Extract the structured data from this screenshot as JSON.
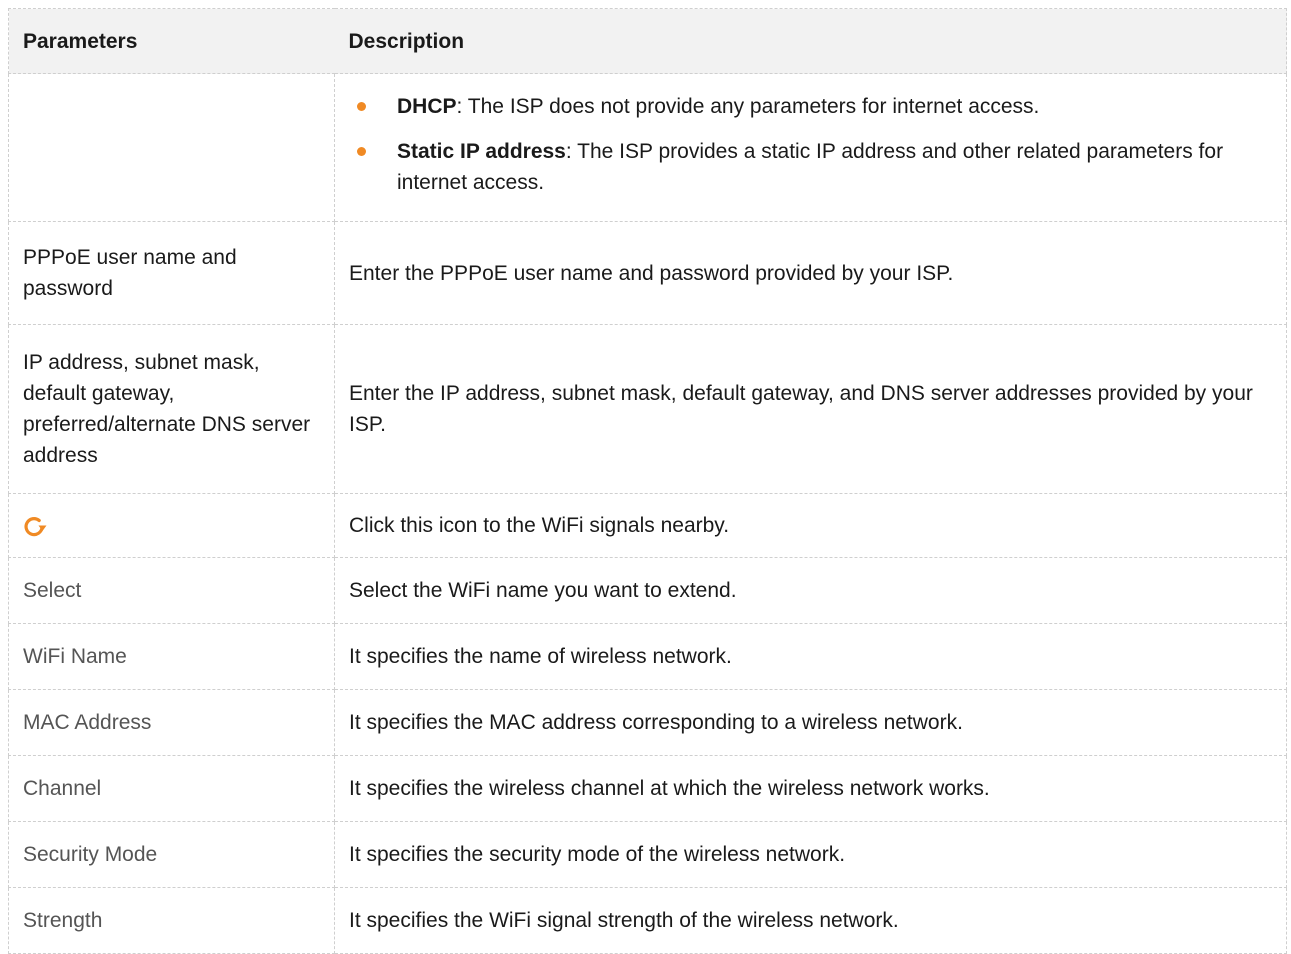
{
  "header": {
    "parameters": "Parameters",
    "description": "Description"
  },
  "bullet_row": {
    "items": [
      {
        "term": "DHCP",
        "text": ": The ISP does not provide any parameters for internet access."
      },
      {
        "term": "Static IP address",
        "text": ": The ISP provides a static IP address and other related parameters for internet access."
      }
    ]
  },
  "rows": [
    {
      "param": "PPPoE user name and password",
      "description": "Enter the PPPoE user name and password provided by your ISP."
    },
    {
      "param": "IP address, subnet mask, default gateway, preferred/alternate DNS server address",
      "description": "Enter the IP address, subnet mask, default gateway, and DNS server addresses provided by your ISP."
    },
    {
      "param_icon": "refresh-icon",
      "description": "Click this icon to the WiFi signals nearby."
    },
    {
      "param": "Select",
      "description": "Select the WiFi name you want to extend."
    },
    {
      "param": "WiFi Name",
      "description": "It specifies the name of wireless network."
    },
    {
      "param": "MAC Address",
      "description": "It specifies the MAC address corresponding to a wireless network."
    },
    {
      "param": "Channel",
      "description": "It specifies the wireless channel at which the wireless network works."
    },
    {
      "param": "Security Mode",
      "description": "It specifies the security mode of the wireless network."
    },
    {
      "param": "Strength",
      "description": "It specifies the WiFi signal strength of the wireless network."
    }
  ],
  "colors": {
    "accent": "#f08a24",
    "header_bg": "#f2f2f2"
  }
}
